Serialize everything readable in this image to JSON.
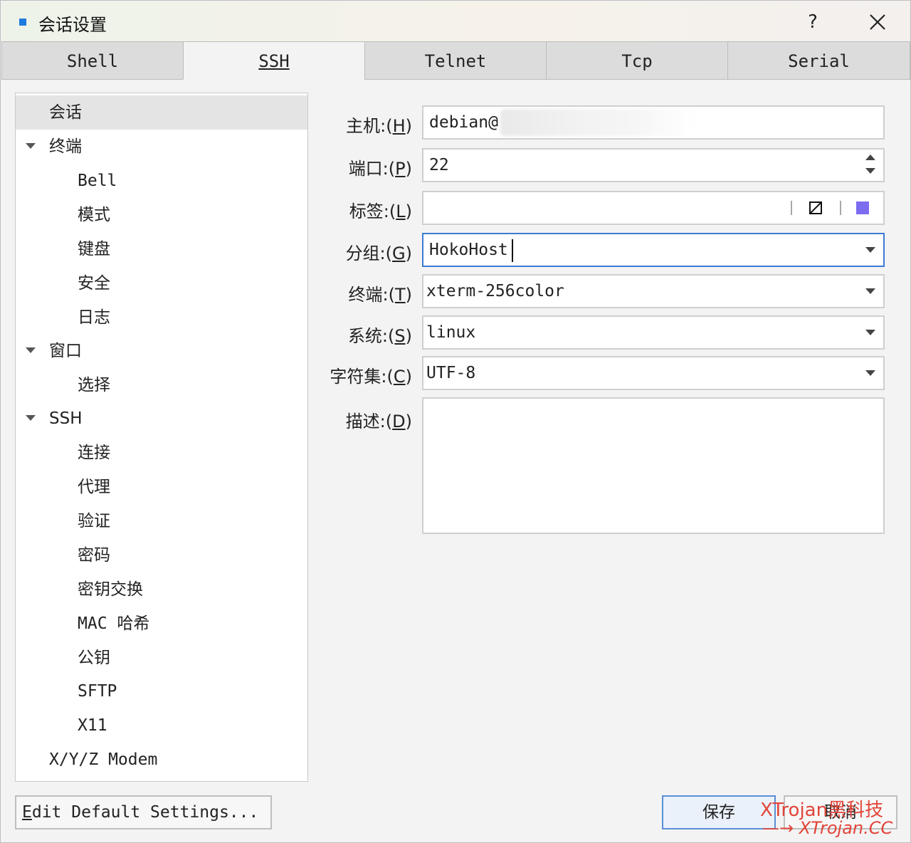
{
  "window": {
    "title": "会话设置",
    "help_label": "?",
    "accent_color": "#1e7be0"
  },
  "tabs": [
    {
      "label": "Shell",
      "active": false
    },
    {
      "label": "SSH",
      "active": true
    },
    {
      "label": "Telnet",
      "active": false
    },
    {
      "label": "Tcp",
      "active": false
    },
    {
      "label": "Serial",
      "active": false
    }
  ],
  "tree": {
    "items": [
      {
        "label": "会话",
        "selected": true
      },
      {
        "label": "终端",
        "expanded": true
      },
      {
        "label": "Bell"
      },
      {
        "label": "模式"
      },
      {
        "label": "键盘"
      },
      {
        "label": "安全"
      },
      {
        "label": "日志"
      },
      {
        "label": "窗口",
        "expanded": true
      },
      {
        "label": "选择"
      },
      {
        "label": "SSH",
        "expanded": true
      },
      {
        "label": "连接"
      },
      {
        "label": "代理"
      },
      {
        "label": "验证"
      },
      {
        "label": "密码"
      },
      {
        "label": "密钥交换"
      },
      {
        "label": "MAC 哈希"
      },
      {
        "label": "公钥"
      },
      {
        "label": "SFTP"
      },
      {
        "label": "X11"
      },
      {
        "label": "X/Y/Z Modem"
      }
    ]
  },
  "form": {
    "host": {
      "label": "主机:(",
      "key": "H",
      "suffix": ")",
      "value": "debian@"
    },
    "port": {
      "label": "端口:(",
      "key": "P",
      "suffix": ")",
      "value": "22"
    },
    "tag": {
      "label": "标签:(",
      "key": "L",
      "suffix": ")",
      "value": "",
      "color": "#7b6cf0"
    },
    "group": {
      "label": "分组:(",
      "key": "G",
      "suffix": ")",
      "value": "HokoHost"
    },
    "terminal": {
      "label": "终端:(",
      "key": "T",
      "suffix": ")",
      "value": "xterm-256color"
    },
    "system": {
      "label": "系统:(",
      "key": "S",
      "suffix": ")",
      "value": "linux"
    },
    "charset": {
      "label": "字符集:(",
      "key": "C",
      "suffix": ")",
      "value": "UTF-8"
    },
    "description": {
      "label": "描述:(",
      "key": "D",
      "suffix": ")",
      "value": ""
    }
  },
  "buttons": {
    "edit_default_key": "E",
    "edit_default_rest": "dit Default Settings...",
    "save": "保存",
    "cancel": "取消"
  },
  "watermark": {
    "line1": "XTrojan黑科技",
    "line2": "—→ XTrojan.CC",
    "color": "#e2453a"
  }
}
